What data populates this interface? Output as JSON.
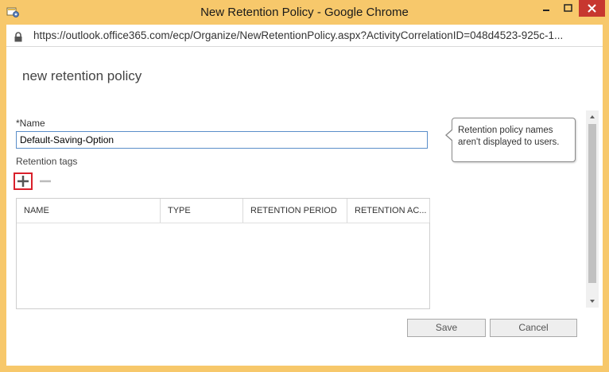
{
  "window": {
    "title": "New Retention Policy - Google Chrome",
    "url": "https://outlook.office365.com/ecp/Organize/NewRetentionPolicy.aspx?ActivityCorrelationID=048d4523-925c-1..."
  },
  "page": {
    "title": "new retention policy"
  },
  "form": {
    "name_label": "*Name",
    "name_value": "Default-Saving-Option",
    "tags_label": "Retention tags"
  },
  "table": {
    "columns": [
      "NAME",
      "TYPE",
      "RETENTION PERIOD",
      "RETENTION AC..."
    ]
  },
  "tooltip": {
    "text": "Retention policy names aren't displayed to users."
  },
  "buttons": {
    "save": "Save",
    "cancel": "Cancel"
  },
  "colors": {
    "titlebar": "#f7c86b",
    "close": "#c7372f",
    "add_highlight": "#d9202b",
    "input_border": "#5a8ec9"
  },
  "icons": {
    "app": "exchange-app-icon",
    "lock": "lock-icon",
    "add": "plus-icon",
    "remove": "minus-icon"
  }
}
